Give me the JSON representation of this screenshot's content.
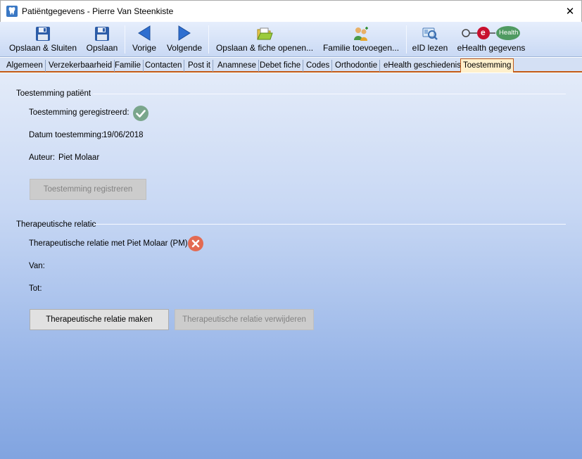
{
  "window": {
    "title": "Patiëntgegevens - Pierre Van Steenkiste",
    "close_glyph": "✕"
  },
  "toolbar": {
    "save_close": "Opslaan & Sluiten",
    "save": "Opslaan",
    "previous": "Vorige",
    "next": "Volgende",
    "save_open_card": "Opslaan & fiche openen...",
    "add_family": "Familie toevoegen...",
    "eid_read": "eID lezen",
    "ehealth_data": "eHealth gegevens",
    "ehealth_logo_e": "e",
    "ehealth_logo_text": "Health"
  },
  "tabs": [
    {
      "label": "Algemeen"
    },
    {
      "label": "Verzekerbaarheid"
    },
    {
      "label": "Familie"
    },
    {
      "label": "Contacten"
    },
    {
      "label": "Post it"
    },
    {
      "label": "Anamnese"
    },
    {
      "label": "Debet fiche"
    },
    {
      "label": "Codes"
    },
    {
      "label": "Orthodontie"
    },
    {
      "label": "eHealth geschiedenis"
    },
    {
      "label": "Toestemming"
    }
  ],
  "consent": {
    "group_title": "Toestemming patiënt",
    "registered_label": "Toestemming geregistreerd:",
    "registered": true,
    "date_label": "Datum toestemming:",
    "date_value": "19/06/2018",
    "author_label": "Auteur:",
    "author_value": "Piet Molaar",
    "register_button": "Toestemming registreren"
  },
  "therapeutic": {
    "group_title": "Therapeutische relatie",
    "relation_label": "Therapeutische relatie met Piet Molaar (PM):",
    "has_relation": false,
    "from_label": "Van:",
    "to_label": "Tot:",
    "make_button": "Therapeutische relatie maken",
    "remove_button": "Therapeutische relatie verwijderen"
  },
  "colors": {
    "status_ok": "#7aa68c",
    "status_error": "#e36a52",
    "active_tab_border": "#c25a16",
    "active_tab_bg": "#fff0cc"
  }
}
